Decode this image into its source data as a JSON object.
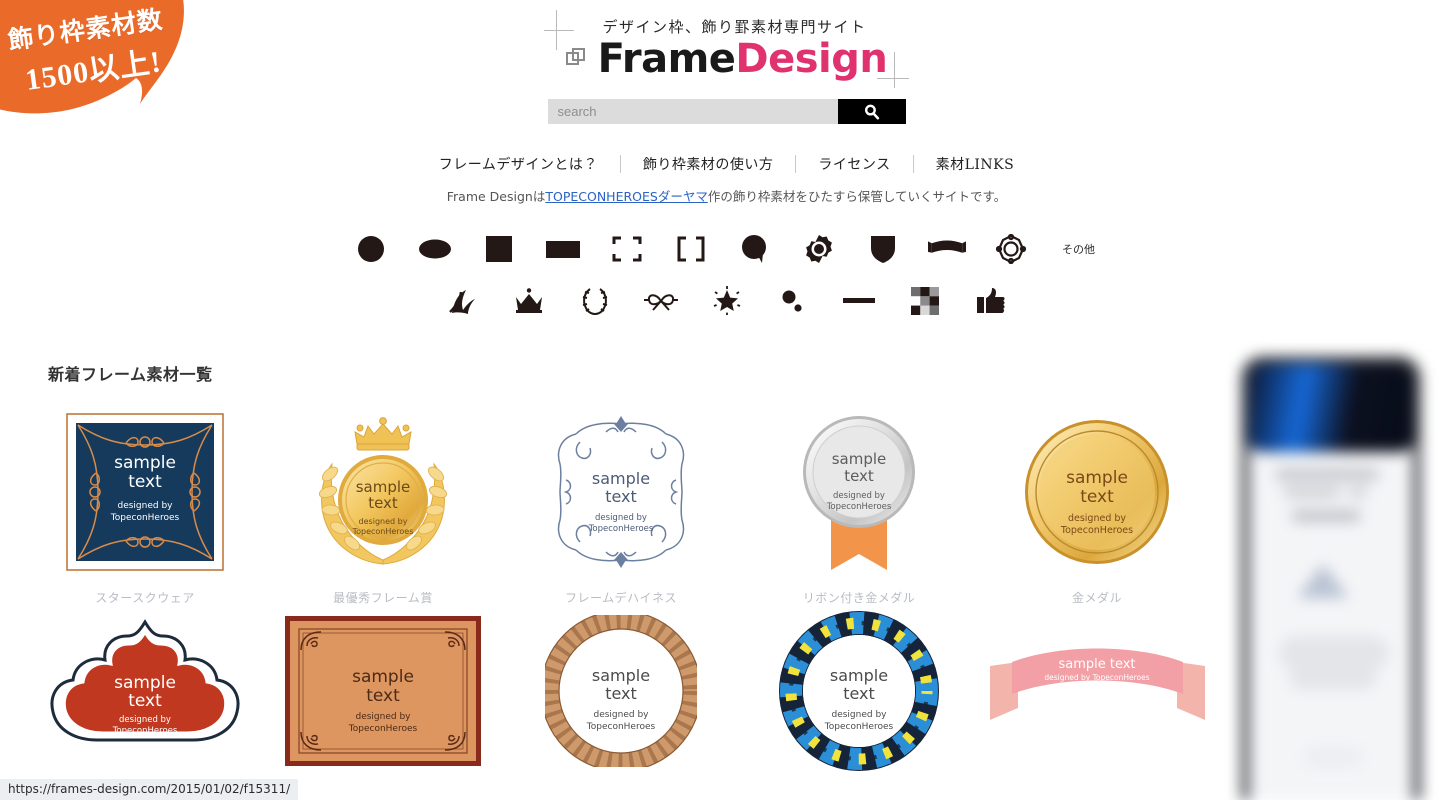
{
  "badge": {
    "line1": "飾り枠素材数",
    "line2": "1500以上!",
    "color": "#ea6a2a"
  },
  "header": {
    "tagline": "デザイン枠、飾り罫素材専門サイト",
    "logo_part1": "Frame",
    "logo_part2": "Design",
    "logo_mark": "overlapping-squares-icon",
    "accent_color": "#e0326e"
  },
  "search": {
    "placeholder": "search",
    "value": "",
    "button_icon": "search-icon"
  },
  "nav": {
    "items": [
      {
        "label": "フレームデザインとは？"
      },
      {
        "label": "飾り枠素材の使い方"
      },
      {
        "label": "ライセンス"
      },
      {
        "label": "素材LINKS"
      }
    ]
  },
  "subline": {
    "before": "Frame Designは",
    "link": "TOPECONHEROESダーヤマ",
    "after": "作の飾り枠素材をひたすら保管していくサイトです。"
  },
  "category_icons": {
    "row1": [
      {
        "name": "circle-icon",
        "label": "円"
      },
      {
        "name": "ellipse-icon",
        "label": "楕円"
      },
      {
        "name": "square-icon",
        "label": "四角"
      },
      {
        "name": "rectangle-icon",
        "label": "長方形"
      },
      {
        "name": "corner-brackets-icon",
        "label": "角括弧"
      },
      {
        "name": "square-brackets-icon",
        "label": "ブラケット"
      },
      {
        "name": "speech-bubble-icon",
        "label": "吹き出し"
      },
      {
        "name": "seal-stamp-icon",
        "label": "印章"
      },
      {
        "name": "shield-icon",
        "label": "盾"
      },
      {
        "name": "ribbon-banner-icon",
        "label": "リボン"
      },
      {
        "name": "flower-ornament-icon",
        "label": "花飾り"
      }
    ],
    "row1_more": "その他",
    "row2": [
      {
        "name": "leaf-swirl-icon",
        "label": "葉・渦"
      },
      {
        "name": "crown-icon",
        "label": "王冠"
      },
      {
        "name": "laurel-wreath-icon",
        "label": "月桂樹"
      },
      {
        "name": "bow-ribbon-icon",
        "label": "蝶結び"
      },
      {
        "name": "starburst-icon",
        "label": "輝き"
      },
      {
        "name": "dots-icon",
        "label": "ドット"
      },
      {
        "name": "line-icon",
        "label": "ライン"
      },
      {
        "name": "checker-icon",
        "label": "チェック"
      },
      {
        "name": "thumbs-up-icon",
        "label": "いいね"
      }
    ]
  },
  "section": {
    "title": "新着フレーム素材一覧"
  },
  "sample_text": {
    "line1": "sample",
    "line2": "text",
    "line3": "designed by",
    "line4": "TopeconHeroes"
  },
  "items": [
    {
      "caption": "スタースクウェア",
      "style": "navy-square-ornate",
      "colors": {
        "bg": "#153a5c",
        "ornament": "#d98c4a",
        "border": "#c07a3e"
      }
    },
    {
      "caption": "最優秀フレーム賞",
      "style": "gold-medal-crown-laurel",
      "colors": {
        "gold": "#f0c75e",
        "gold_dark": "#c8922e"
      }
    },
    {
      "caption": "フレームデハイネス",
      "style": "blue-ornate-frame",
      "colors": {
        "line": "#6c7fa0"
      }
    },
    {
      "caption": "リボン付き金メダル",
      "style": "silver-medal-ribbon",
      "colors": {
        "metal": "#d8d8d8",
        "ribbon": "#f2954a"
      }
    },
    {
      "caption": "金メダル",
      "style": "gold-medal",
      "colors": {
        "gold": "#f2c96a",
        "gold_dark": "#c08c2c"
      }
    },
    {
      "caption": "",
      "style": "red-crown-cloud",
      "colors": {
        "fill": "#c0381f",
        "outline": "#1d2b3a"
      }
    },
    {
      "caption": "",
      "style": "tan-certificate",
      "colors": {
        "fill": "#dd9660",
        "border": "#8a2a1d"
      }
    },
    {
      "caption": "",
      "style": "rope-circle",
      "colors": {
        "rope": "#cf9a6b"
      }
    },
    {
      "caption": "",
      "style": "blue-yellow-twist-circle",
      "colors": {
        "blue": "#2b8fd8",
        "yellow": "#f2e33c",
        "dark": "#16243a"
      }
    },
    {
      "caption": "",
      "style": "pink-banner-ribbon",
      "colors": {
        "fill": "#f2a0a6"
      }
    }
  ],
  "statusbar": {
    "url": "https://frames-design.com/2015/01/02/f15311/"
  }
}
